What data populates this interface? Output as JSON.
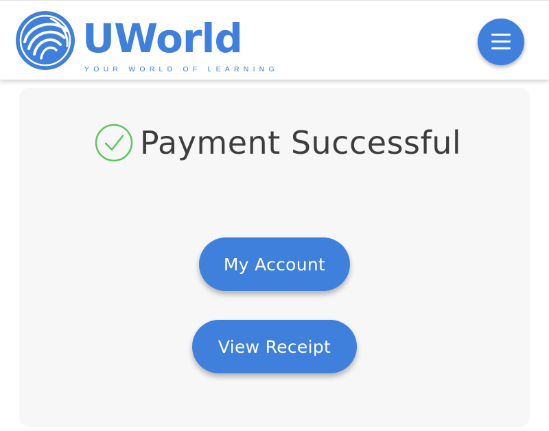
{
  "header": {
    "brand_name": "UWorld",
    "tagline": "YOUR WORLD OF LEARNING",
    "menu_icon": "hamburger-menu-icon"
  },
  "main": {
    "status_icon": "check-circle-icon",
    "title": "Payment Successful",
    "buttons": {
      "my_account_label": "My Account",
      "view_receipt_label": "View Receipt"
    }
  },
  "colors": {
    "brand_blue": "#3f80dc",
    "success_green": "#5cc55c",
    "title_text": "#3d3d3d",
    "card_background": "#f7f7f7"
  }
}
